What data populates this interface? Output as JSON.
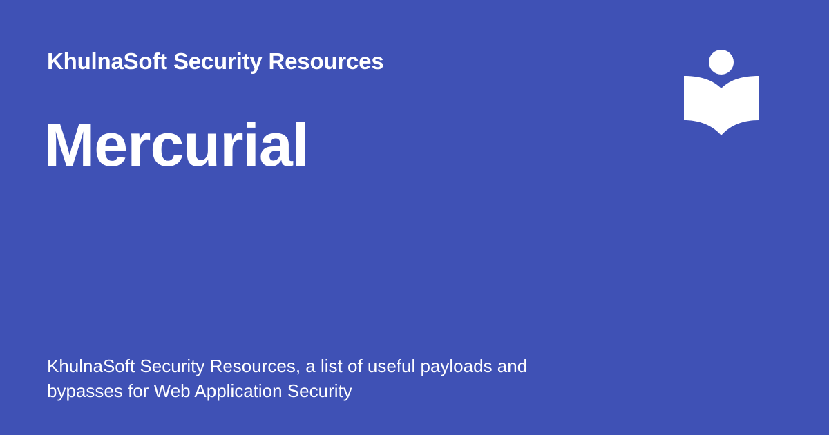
{
  "site": {
    "name": "KhulnaSoft Security Resources",
    "logo_icon": "reading-person-book-icon"
  },
  "page": {
    "title": "Mercurial",
    "description": "KhulnaSoft Security Resources, a list of useful payloads and bypasses for Web Application Security"
  },
  "colors": {
    "background": "#3f51b5",
    "text": "#ffffff"
  }
}
